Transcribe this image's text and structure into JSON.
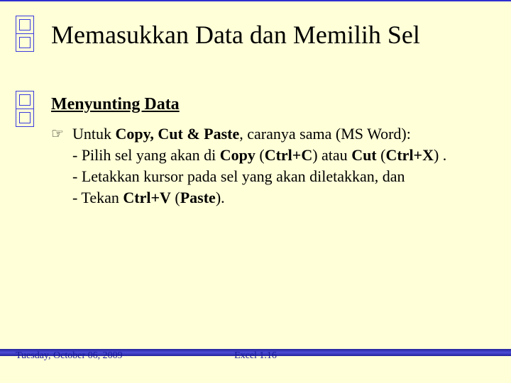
{
  "title": "Memasukkan Data dan Memilih Sel",
  "subtitle": "Menyunting Data",
  "bullet": {
    "lead_plain1": "Untuk ",
    "lead_bold": "Copy, Cut & Paste",
    "lead_plain2": ", caranya sama (MS Word):",
    "line1_a": "- Pilih sel yang akan di ",
    "line1_b": "Copy",
    "line1_c": " (",
    "line1_d": "Ctrl+C",
    "line1_e": ") atau ",
    "line1_f": "Cut",
    "line1_g": " (",
    "line1_h": "Ctrl+X",
    "line1_i": ") .",
    "line2": "- Letakkan kursor pada sel yang akan diletakkan, dan",
    "line3_a": "- Tekan ",
    "line3_b": "Ctrl+V",
    "line3_c": " (",
    "line3_d": "Paste",
    "line3_e": ")."
  },
  "footer": {
    "left": "Tuesday, October 06, 2009",
    "center": "Excel 1.16"
  }
}
